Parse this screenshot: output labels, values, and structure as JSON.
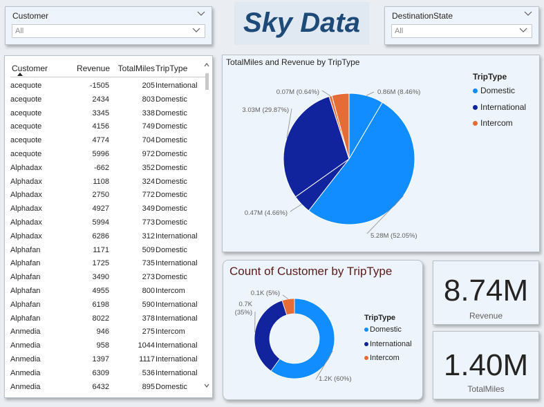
{
  "slicers": {
    "customer": {
      "title": "Customer",
      "value": "All"
    },
    "destination_state": {
      "title": "DestinationState",
      "value": "All"
    }
  },
  "title": "Sky Data",
  "table": {
    "columns": [
      "Customer",
      "Revenue",
      "TotalMiles",
      "TripType"
    ],
    "rows": [
      [
        "acequote",
        "-1505",
        "205",
        "International"
      ],
      [
        "acequote",
        "2434",
        "803",
        "Domestic"
      ],
      [
        "acequote",
        "3345",
        "338",
        "Domestic"
      ],
      [
        "acequote",
        "4156",
        "749",
        "Domestic"
      ],
      [
        "acequote",
        "4774",
        "704",
        "Domestic"
      ],
      [
        "acequote",
        "5996",
        "972",
        "Domestic"
      ],
      [
        "Alphadax",
        "-662",
        "352",
        "Domestic"
      ],
      [
        "Alphadax",
        "1108",
        "324",
        "Domestic"
      ],
      [
        "Alphadax",
        "2750",
        "772",
        "Domestic"
      ],
      [
        "Alphadax",
        "4927",
        "349",
        "Domestic"
      ],
      [
        "Alphadax",
        "5994",
        "773",
        "Domestic"
      ],
      [
        "Alphadax",
        "6286",
        "312",
        "International"
      ],
      [
        "Alphafan",
        "1171",
        "509",
        "Domestic"
      ],
      [
        "Alphafan",
        "1725",
        "735",
        "International"
      ],
      [
        "Alphafan",
        "3490",
        "273",
        "Domestic"
      ],
      [
        "Alphafan",
        "4955",
        "800",
        "Intercom"
      ],
      [
        "Alphafan",
        "6198",
        "590",
        "International"
      ],
      [
        "Alphafan",
        "8022",
        "378",
        "International"
      ],
      [
        "Anmedia",
        "946",
        "275",
        "Intercom"
      ],
      [
        "Anmedia",
        "958",
        "1044",
        "International"
      ],
      [
        "Anmedia",
        "1397",
        "1117",
        "International"
      ],
      [
        "Anmedia",
        "6309",
        "536",
        "International"
      ],
      [
        "Anmedia",
        "6432",
        "895",
        "Domestic"
      ]
    ]
  },
  "colors": {
    "domestic": "#118dff",
    "international": "#12239e",
    "intercom": "#e66c37"
  },
  "chart_data": [
    {
      "type": "pie",
      "title": "TotalMiles and Revenue by TripType",
      "legend_title": "TripType",
      "legend_position": "top-right",
      "slices": [
        {
          "label": "0.86M (8.46%)",
          "value": 0.86,
          "series": "Domestic"
        },
        {
          "label": "5.28M (52.05%)",
          "value": 5.28,
          "series": "Domestic"
        },
        {
          "label": "0.47M (4.66%)",
          "value": 0.47,
          "series": "International"
        },
        {
          "label": "3.03M (29.87%)",
          "value": 3.03,
          "series": "International"
        },
        {
          "label": "0.07M (0.64%)",
          "value": 0.07,
          "series": "Intercom"
        },
        {
          "label": "0.43M (4.32%)",
          "value": 0.43,
          "series": "Intercom",
          "label_shown": false
        }
      ],
      "legend": [
        "Domestic",
        "International",
        "Intercom"
      ]
    },
    {
      "type": "donut",
      "title": "Count of Customer by TripType",
      "legend_title": "TripType",
      "legend_position": "right",
      "slices": [
        {
          "label": "1.2K (60%)",
          "value": 60,
          "series": "Domestic"
        },
        {
          "label": "0.7K (35%)",
          "value": 35,
          "series": "International"
        },
        {
          "label": "0.1K (5%)",
          "value": 5,
          "series": "Intercom"
        }
      ],
      "legend": [
        "Domestic",
        "International",
        "Intercom"
      ]
    }
  ],
  "cards": {
    "revenue": {
      "value": "8.74M",
      "label": "Revenue"
    },
    "total_miles": {
      "value": "1.40M",
      "label": "TotalMiles"
    }
  }
}
